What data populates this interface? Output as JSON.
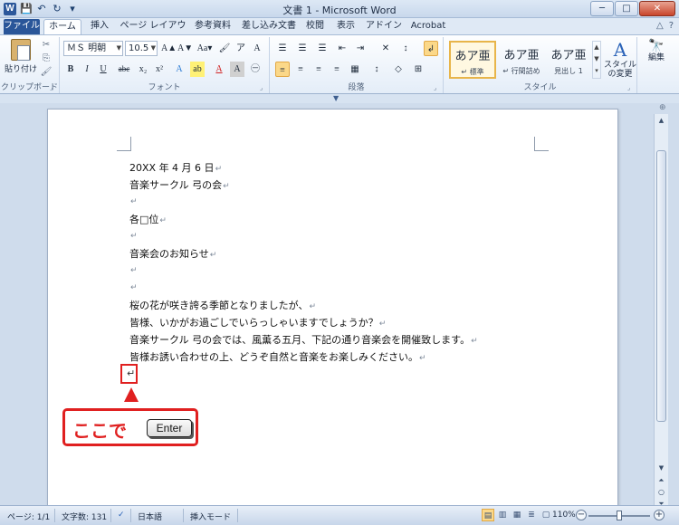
{
  "window": {
    "title": "文書 1 - Microsoft Word",
    "app_icon": "W",
    "qat": [
      {
        "icon": "save-icon",
        "glyph": "💾"
      },
      {
        "icon": "undo-icon",
        "glyph": "↶"
      },
      {
        "icon": "redo-icon",
        "glyph": "↻"
      },
      {
        "icon": "customize-icon",
        "glyph": "▾"
      }
    ],
    "controls": {
      "minimize": "─",
      "maximize": "□",
      "close": "✕"
    }
  },
  "tabs": [
    "ファイル",
    "ホーム",
    "挿入",
    "ページ レイアウト",
    "参考資料",
    "差し込み文書",
    "校閲",
    "表示",
    "アドイン",
    "Acrobat"
  ],
  "tabrow_right": {
    "collapse": "△",
    "help": "?"
  },
  "ribbon": {
    "clipboard": {
      "paste_label": "貼り付け",
      "label": "クリップボード",
      "small": [
        "✂",
        "⎘",
        "🖌"
      ]
    },
    "font": {
      "label": "フォント",
      "font_name": "ＭＳ 明朝",
      "font_size": "10.5",
      "row1": [
        "A▲",
        "A▼",
        "Aa▾",
        "🖌",
        "ア",
        "A"
      ],
      "row2": [
        "B",
        "I",
        "U",
        "abc",
        "x₂",
        "x²",
        "A",
        "ab",
        "A",
        "A",
        "㊀"
      ]
    },
    "paragraph": {
      "label": "段落",
      "row1": [
        "☰",
        "☰",
        "☰",
        "⇤",
        "⇥",
        "✕",
        "↕"
      ],
      "row2": [
        "≡",
        "≡",
        "≡",
        "≡",
        "▦",
        "↕",
        "◇",
        "⊞"
      ],
      "show_marks": "↲"
    },
    "styles": {
      "label": "スタイル",
      "items": [
        {
          "sample": "あア亜",
          "name": "↵ 標準"
        },
        {
          "sample": "あア亜",
          "name": "↵ 行間詰め"
        },
        {
          "sample": "あア亜",
          "name": "見出し 1"
        }
      ],
      "change_label": "スタイルの変更",
      "change_icon": "A"
    },
    "editing": {
      "label": "編集",
      "icon": "🔭"
    }
  },
  "document": {
    "lines": [
      "20XX 年 4 月 6 日",
      "音楽サークル 弓の会",
      "",
      "各□位",
      "",
      "音楽会のお知らせ",
      "",
      "",
      "桜の花が咲き誇る季節となりましたが、",
      "皆様、いかがお過ごしでいらっしゃいますでしょうか？",
      "音楽サークル 弓の会では、風薫る五月、下記の通り音楽会を開催致します。",
      "皆様お誘い合わせの上、どうぞ自然と音楽をお楽しみください。"
    ],
    "para_mark": "↵",
    "callout_text": "ここで",
    "enter_key": "Enter"
  },
  "statusbar": {
    "page": "ページ: 1/1",
    "words": "文字数: 131",
    "proof_icon": "✓",
    "language": "日本語",
    "mode": "挿入モード",
    "zoom": "110%",
    "zoom_out": "−",
    "zoom_in": "+"
  }
}
